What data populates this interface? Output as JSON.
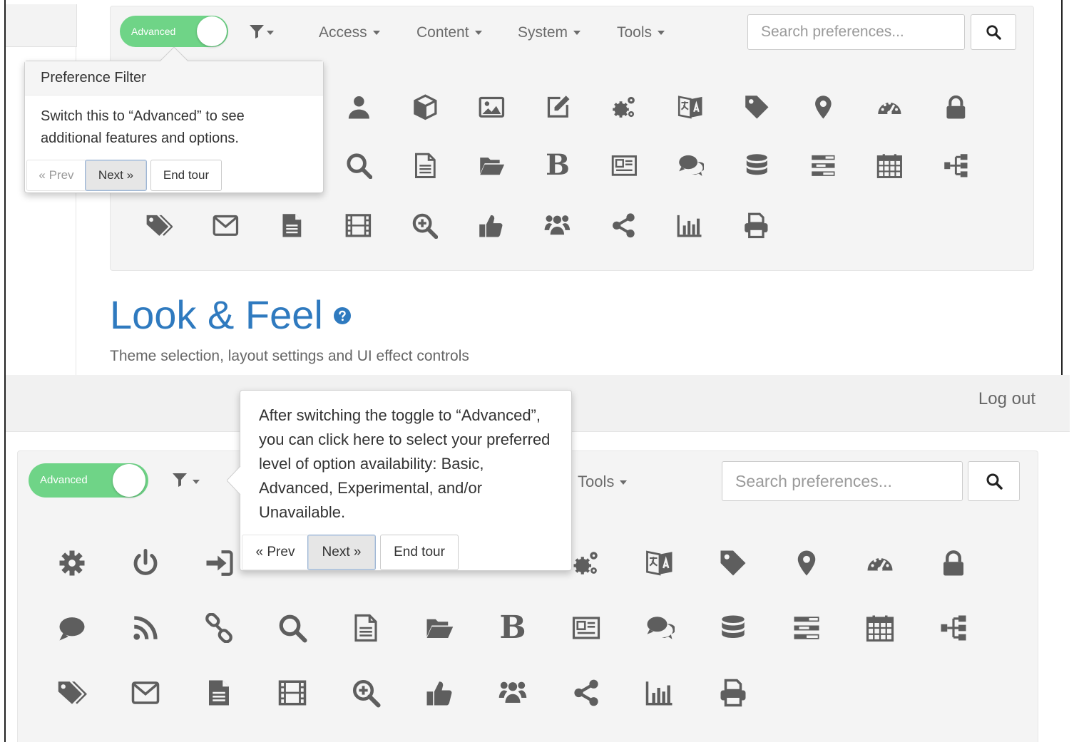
{
  "top": {
    "toggle_label": "Advanced",
    "nav": [
      "Access",
      "Content",
      "System",
      "Tools"
    ],
    "search_placeholder": "Search preferences...",
    "popover": {
      "title": "Preference Filter",
      "body": "Switch this to “Advanced” to see additional features and options.",
      "prev": "« Prev",
      "next": "Next »",
      "end": "End tour"
    },
    "icons_row1": [
      "user-icon",
      "cube-icon",
      "image-icon",
      "edit-icon",
      "cogs-icon",
      "language-icon",
      "tag-icon",
      "map-marker-icon",
      "dashboard-icon",
      "lock-icon"
    ],
    "icons_row2": [
      "search-icon",
      "file-text-icon",
      "folder-open-icon",
      "bold-icon",
      "newspaper-icon",
      "comments-icon",
      "database-icon",
      "tasks-icon",
      "calendar-icon",
      "sitemap-icon"
    ],
    "icons_row3": [
      "tags-icon",
      "envelope-icon",
      "file-icon",
      "film-icon",
      "zoom-in-icon",
      "thumbs-up-icon",
      "users-icon",
      "share-alt-icon",
      "bar-chart-icon",
      "print-icon"
    ]
  },
  "heading": {
    "title": "Look & Feel",
    "subtitle": "Theme selection, layout settings and UI effect controls"
  },
  "bar": {
    "logout": "Log out"
  },
  "bottom": {
    "toggle_label": "Advanced",
    "nav_tools": "Tools",
    "search_placeholder": "Search preferences...",
    "popover": {
      "body": "After switching the toggle to “Advanced”, you can click here to select your preferred level of option availability: Basic, Advanced, Experimental, and/or Unavailable.",
      "prev": "« Prev",
      "next": "Next »",
      "end": "End tour"
    },
    "icons_row1": [
      "cog-icon",
      "power-off-icon",
      "sign-in-icon",
      "cogs-icon",
      "language-icon",
      "tag-icon",
      "map-marker-icon",
      "dashboard-icon",
      "lock-icon"
    ],
    "icons_row2": [
      "comment-icon",
      "rss-icon",
      "link-icon",
      "search-icon",
      "file-text-icon",
      "folder-open-icon",
      "bold-icon",
      "newspaper-icon",
      "comments-icon",
      "database-icon",
      "tasks-icon",
      "calendar-icon",
      "sitemap-icon"
    ],
    "icons_row3": [
      "tags-icon",
      "envelope-icon",
      "file-icon",
      "film-icon",
      "zoom-in-icon",
      "thumbs-up-icon",
      "users-icon",
      "share-alt-icon",
      "bar-chart-icon",
      "print-icon"
    ]
  },
  "colors": {
    "accent": "#2f7abf",
    "toggle_on": "#6fd487",
    "icon": "#5e5e5e"
  }
}
